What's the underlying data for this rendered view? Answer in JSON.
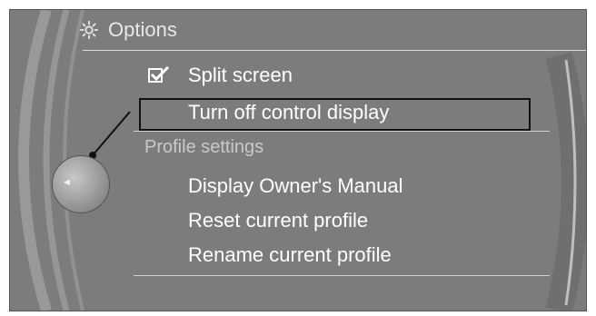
{
  "header": {
    "title": "Options",
    "icon": "gear-icon"
  },
  "menu": {
    "split_screen": {
      "label": "Split screen",
      "checked": true
    },
    "turn_off_display": {
      "label": "Turn off control display",
      "selected": true
    },
    "section_profile": "Profile settings",
    "items": [
      "Display Owner's Manual",
      "Reset current profile",
      "Rename current profile"
    ]
  },
  "controller": {
    "icon": "left-arrow-icon",
    "glyph": "◄"
  },
  "colors": {
    "background": "#7c7c7c",
    "text": "#ffffff",
    "section_text": "#c9c9c9",
    "highlight_border": "#111111"
  }
}
